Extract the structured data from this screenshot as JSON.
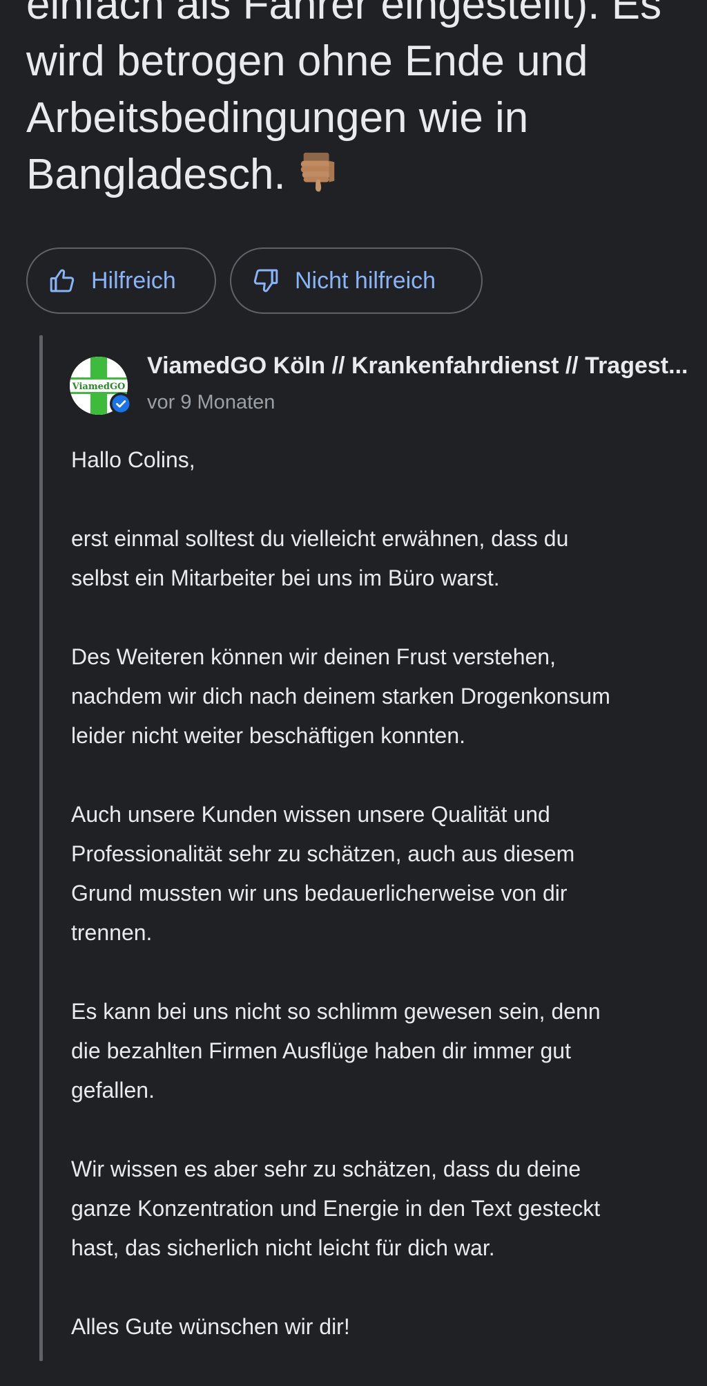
{
  "review": {
    "lines": [
      "einfach als Fahrer eingestellt). Es",
      "wird betrogen ohne Ende und",
      "Arbeitsbedingungen wie in",
      "Bangladesch."
    ],
    "emoji": "thumbs-down-emoji"
  },
  "actions": {
    "helpful_label": "Hilfreich",
    "not_helpful_label": "Nicht hilfreich"
  },
  "owner_reply": {
    "name": "ViamedGO Köln // Krankenfahrdienst // Tragest...",
    "time": "vor 9 Monaten",
    "avatar_text": "ViamedGO",
    "paragraphs": [
      [
        "Hallo Colins,"
      ],
      [
        "erst einmal solltest du vielleicht erwähnen, dass du",
        "selbst ein Mitarbeiter bei uns im Büro warst."
      ],
      [
        "Des Weiteren können wir deinen Frust verstehen,",
        "nachdem wir dich nach deinem starken Drogenkonsum",
        "leider nicht weiter beschäftigen konnten."
      ],
      [
        "Auch unsere Kunden wissen unsere Qualität und",
        "Professionalität sehr zu schätzen, auch aus diesem",
        "Grund mussten wir uns bedauerlicherweise von dir",
        "trennen."
      ],
      [
        "Es kann bei uns nicht so schlimm gewesen sein, denn",
        "die bezahlten Firmen Ausflüge haben dir immer gut",
        "gefallen."
      ],
      [
        "Wir wissen es aber sehr zu schätzen, dass du deine",
        "ganze Konzentration und Energie in den Text gesteckt",
        "hast, das sicherlich nicht leicht für dich war."
      ],
      [
        "Alles Gute wünschen wir dir!"
      ]
    ]
  },
  "colors": {
    "background": "#202124",
    "text": "#e8eaed",
    "secondary_text": "#9aa0a6",
    "link_blue": "#8ab4f8",
    "border": "#5f6368",
    "avatar_green": "#3dbb3d",
    "verified_blue": "#1a73e8"
  }
}
